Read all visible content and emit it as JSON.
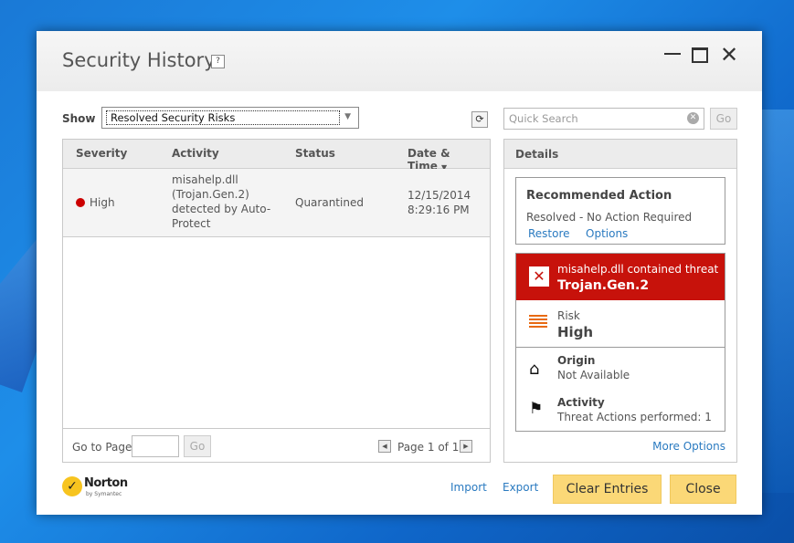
{
  "window": {
    "title": "Security History",
    "help": "?",
    "controls": {
      "minimize": "minimize-icon",
      "maximize": "maximize-icon",
      "close": "close-icon"
    }
  },
  "toolbar": {
    "show_label": "Show",
    "show_value": "Resolved Security Risks",
    "refresh_icon": "refresh-icon",
    "search_placeholder": "Quick Search",
    "go_label": "Go"
  },
  "table": {
    "columns": [
      "Severity",
      "Activity",
      "Status",
      "Date & Time"
    ],
    "sorted_column": "Date & Time",
    "rows": [
      {
        "severity": "High",
        "activity": "misahelp.dll (Trojan.Gen.2) detected by Auto-Protect",
        "status": "Quarantined",
        "date": "12/15/2014",
        "time": "8:29:16 PM"
      }
    ]
  },
  "pager": {
    "goto_label": "Go to Page:",
    "go_label": "Go",
    "page_text": "Page 1 of 1"
  },
  "details": {
    "header": "Details",
    "recommended": {
      "title": "Recommended Action",
      "text": "Resolved - No Action Required",
      "restore": "Restore",
      "options": "Options"
    },
    "threat": {
      "line": "misahelp.dll contained threat",
      "name": "Trojan.Gen.2",
      "risk_label": "Risk",
      "risk_value": "High",
      "origin_label": "Origin",
      "origin_value": "Not Available",
      "activity_label": "Activity",
      "activity_value": "Threat Actions performed: 1"
    },
    "more_options": "More Options"
  },
  "footer": {
    "brand": "Norton",
    "brand_sub": "by Symantec",
    "import": "Import",
    "export": "Export",
    "clear_entries": "Clear Entries",
    "close": "Close"
  },
  "colors": {
    "threat_red": "#c7120b",
    "button_yellow": "#fbd877",
    "link_blue": "#2a7ac0",
    "desktop_blue": "#1a79d6"
  }
}
